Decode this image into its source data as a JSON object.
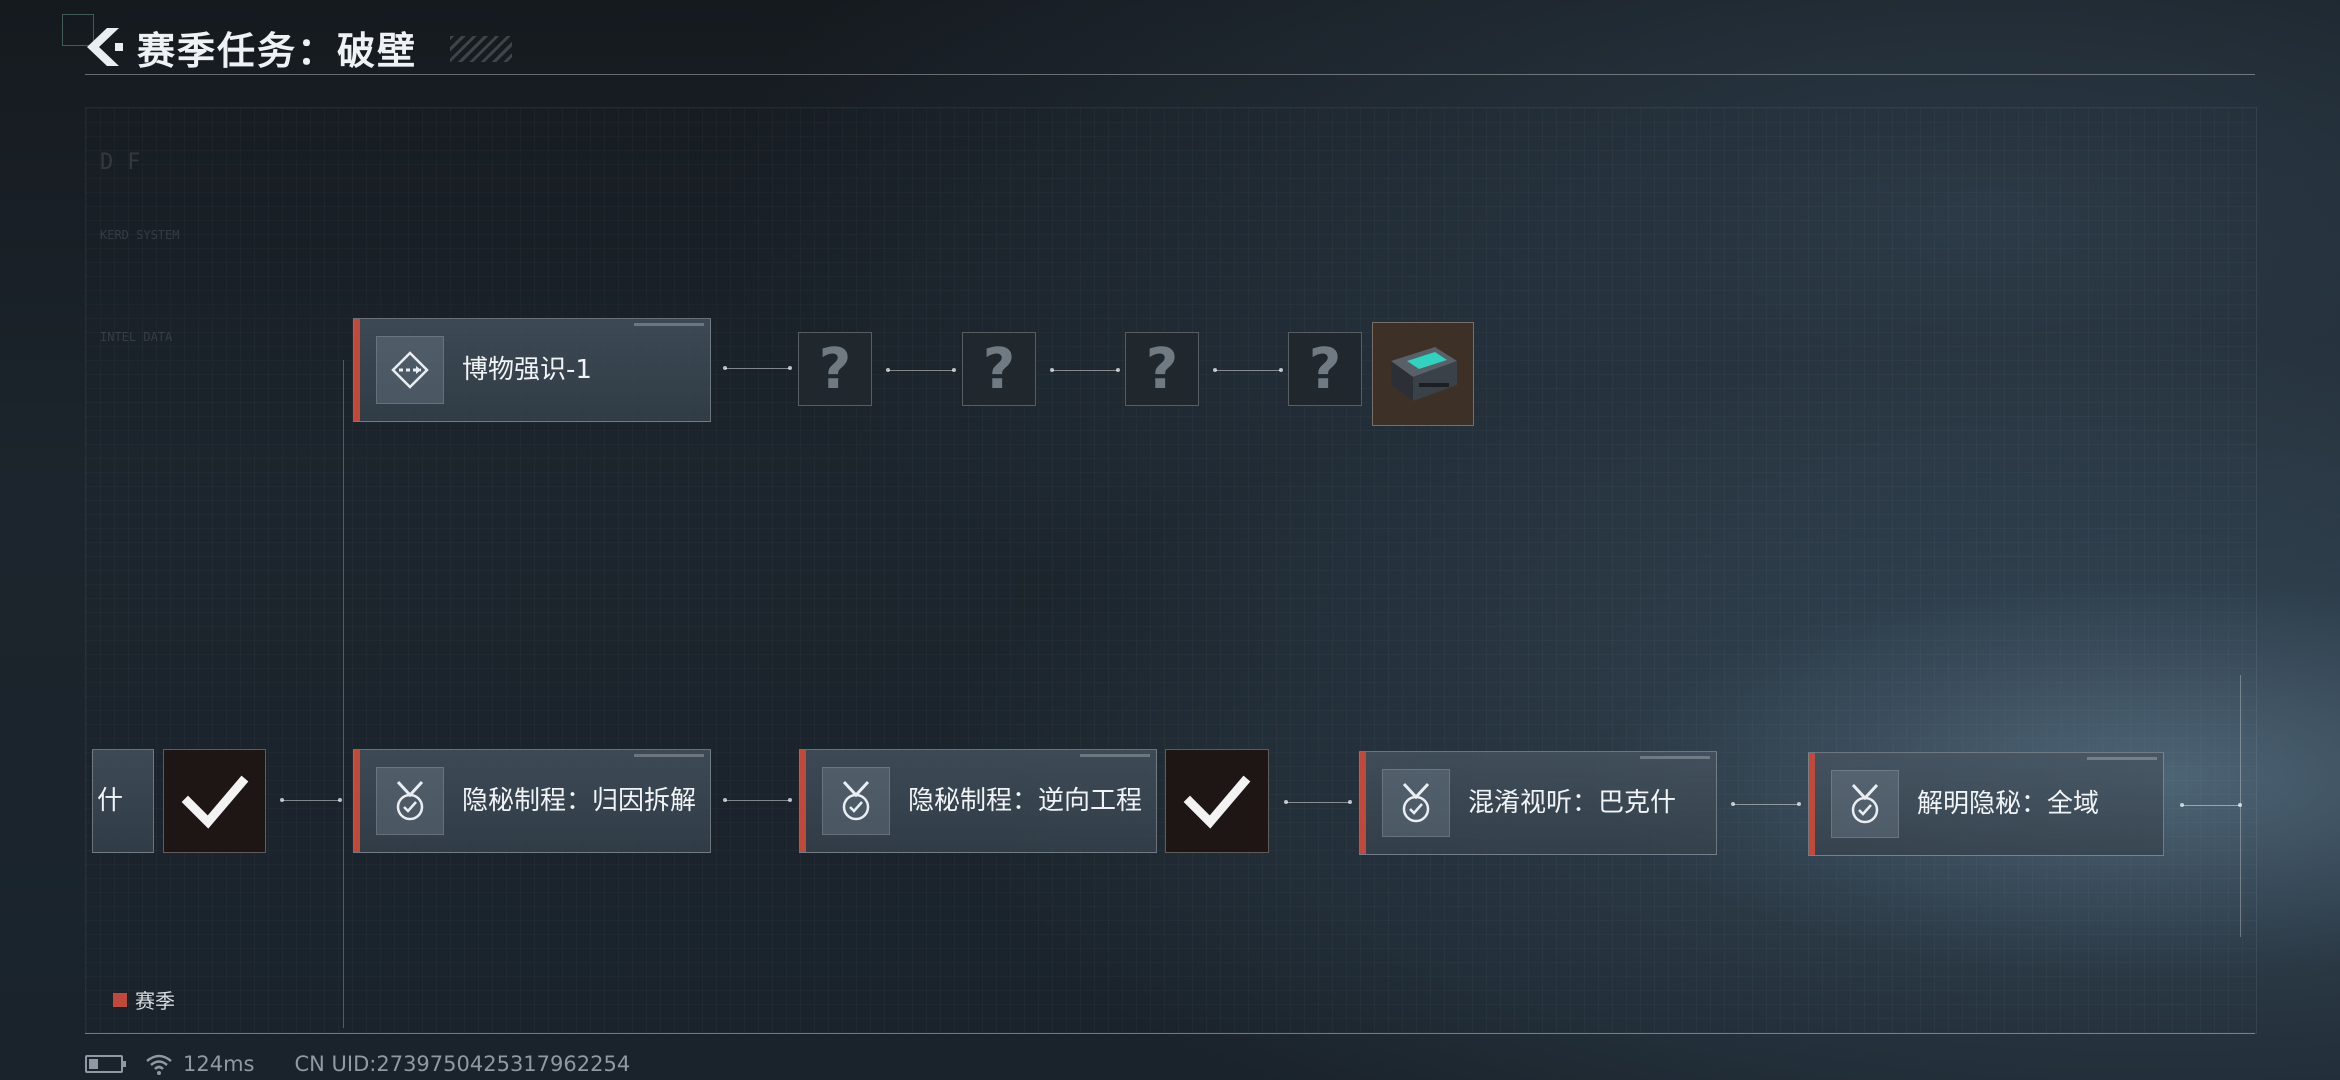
{
  "header": {
    "title": "赛季任务：破壁",
    "back_icon": "back-arrow-icon"
  },
  "top_row": {
    "task": {
      "label": "博物强识-1",
      "icon": "diamond-arrows-icon"
    },
    "unknowns": [
      "?",
      "?",
      "?",
      "?"
    ],
    "reward_icon": "equipment-case-icon"
  },
  "bottom_row": {
    "partial_label": "什",
    "tasks": [
      {
        "label": "隐秘制程：归因拆解",
        "icon": "medal-icon"
      },
      {
        "label": "隐秘制程：逆向工程",
        "icon": "medal-icon"
      },
      {
        "label": "混淆视听：巴克什",
        "icon": "medal-icon"
      },
      {
        "label": "解明隐秘：全域",
        "icon": "medal-icon"
      }
    ],
    "completed_icon": "check-icon"
  },
  "legend": {
    "label": "赛季",
    "color": "#c0493a"
  },
  "status_bar": {
    "ping": "124ms",
    "uid": "CN UID:2739750425317962254"
  },
  "ghost_text": {
    "line1": "DF",
    "line2": "KERD SYSTEM",
    "line3": "INTEL DATA"
  },
  "colors": {
    "accent": "#c0493a",
    "card": "#4a5763"
  }
}
